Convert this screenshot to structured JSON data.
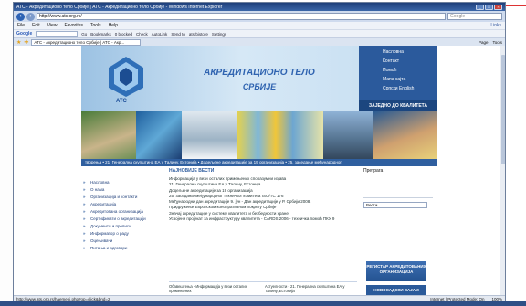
{
  "window": {
    "title": "АТС - Акредитационо тело Србије | АТС - Акредитационо тело Србије - Windows Internet Explorer"
  },
  "address_bar": {
    "url": "http://www.ats.org.rs/",
    "search_placeholder": "Google"
  },
  "menu": [
    "File",
    "Edit",
    "View",
    "Favorites",
    "Tools",
    "Help"
  ],
  "menu_links": "Links",
  "google_toolbar": {
    "logo": "Google",
    "search_value": "акредитационо тело србије",
    "items": [
      "Go",
      "Bookmarks",
      "0 blocked",
      "Check",
      "AutoLink",
      "Send to",
      "atsrbistore",
      "Settings"
    ]
  },
  "tab_bar": {
    "tab_label": "АТС - Акредитационо тело Србије | АТС - Акр...",
    "tools": [
      "Page",
      "Tools"
    ]
  },
  "site": {
    "logo_text": "ATC",
    "title": "АКРЕДИТАЦИОНО ТЕЛО",
    "subtitle": "СРБИЈЕ",
    "side_nav": [
      "Насловна",
      "Контакт",
      "Помоћ",
      "Мапа сајта"
    ],
    "languages": "Српски  English",
    "motto": "ЗАЈЕДНО ДО КВАЛИТЕТА",
    "ticker": "творења   •  21. Генерална скупштина ЕА у Талину, Естонија   •  Додељене акредитације за 19 организација   •  25. заседање међународног",
    "left_nav": [
      "Насловна",
      "О нама",
      "Организација и контакти",
      "Акредитација",
      "Акредитована организација",
      "Сертификати о акредитацији",
      "Документи и прописи",
      "Информатор о раду",
      "Оцењивачи",
      "Питања и одговори"
    ],
    "news_heading": "НАЈНОВИЈЕ ВЕСТИ",
    "news": [
      "Информација у вези осталих примењених споразумни изјава",
      "21. Генерална скупштина ЕА у Талину, Естонија",
      "Додељене акредитације за 19 организација",
      "25. заседање међународног техничког комитета ISO/TC 176",
      "Међународни дан акредитације 9. јун - Дан акредитације у Р. Србији 2008.",
      "Придружење Европском конопративном покрету Србије",
      "Значај акредитације у систему квалитета и безбедности хране",
      "Усвојени пројекат за инфраструктуру квалитета - CARDS 2006 - техничка помоћ ПКУ 9"
    ],
    "news_footer": [
      "Обавештења - Информација у вези осталих примењених",
      "Актуелности - 21. Генерална скупштина ЕА у Талину, Естонија"
    ],
    "right_heading": "Претрага",
    "right_select": "Вести",
    "banner1": "РЕГИСТАР АКРЕДИТОВАНИХ ОРГАНИЗАЦИЈА",
    "banner2": "НОВОСАДСКИ САЈАМ"
  },
  "status_bar": {
    "url": "http://www.ats.org.rs/haemeni.php?op=click&bnd=2",
    "zone": "Internet | Protected Mode: On",
    "zoom": "100%"
  }
}
